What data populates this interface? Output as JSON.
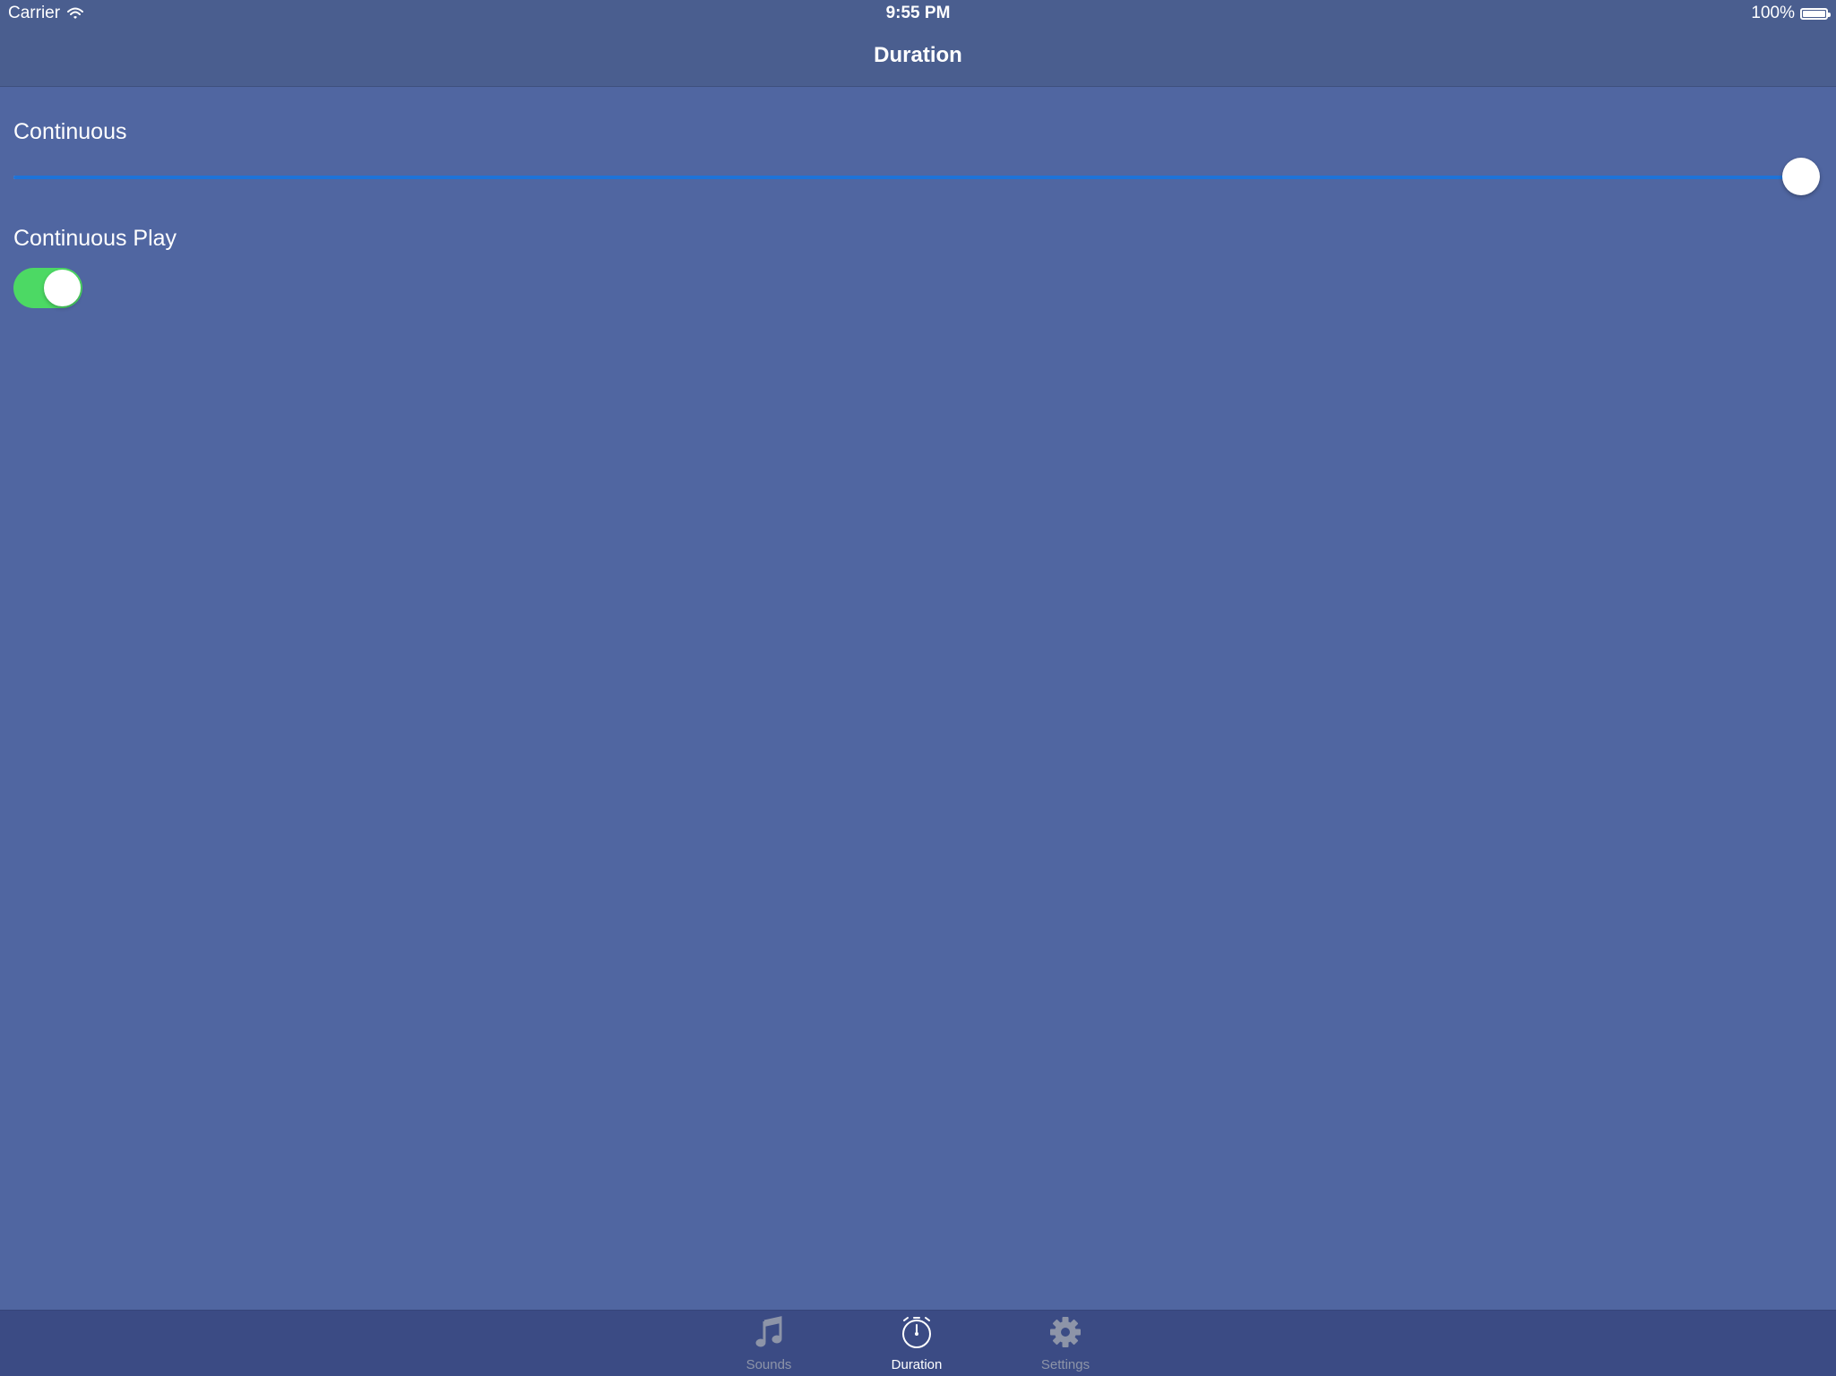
{
  "status_bar": {
    "carrier": "Carrier",
    "time": "9:55 PM",
    "battery_percent": "100%"
  },
  "nav": {
    "title": "Duration"
  },
  "duration_slider": {
    "label": "Continuous",
    "value_fraction": 1.0
  },
  "continuous_play": {
    "label": "Continuous Play",
    "on": true
  },
  "tabs": [
    {
      "label": "Sounds",
      "icon": "music-note-icon",
      "active": false
    },
    {
      "label": "Duration",
      "icon": "stopwatch-icon",
      "active": true
    },
    {
      "label": "Settings",
      "icon": "gear-icon",
      "active": false
    }
  ],
  "colors": {
    "background": "#5066a1",
    "nav_bar": "#4a5e8f",
    "tab_bar": "#3b4b84",
    "slider_fill": "#1e73d8",
    "toggle_on": "#4cd964",
    "tab_inactive": "#8d94a8"
  }
}
